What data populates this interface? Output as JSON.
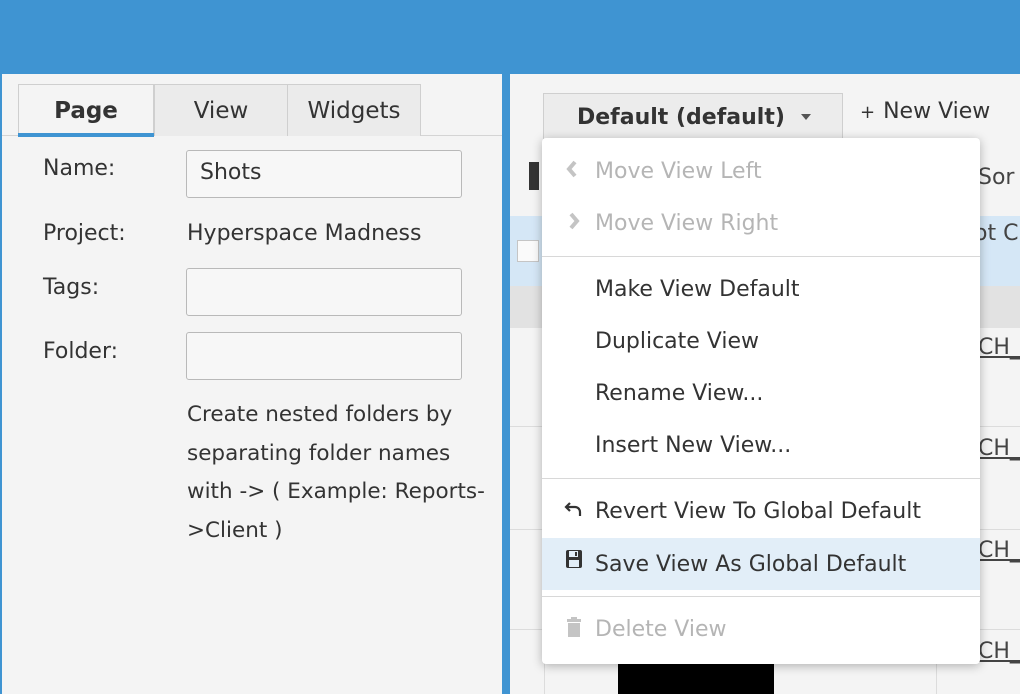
{
  "left_panel": {
    "tabs": [
      {
        "label": "Page"
      },
      {
        "label": "View"
      },
      {
        "label": "Widgets"
      }
    ],
    "form": {
      "name_label": "Name:",
      "name_value": "Shots",
      "project_label": "Project:",
      "project_value": "Hyperspace Madness",
      "tags_label": "Tags:",
      "tags_value": "",
      "folder_label": "Folder:",
      "folder_value": "",
      "folder_help": "Create nested folders by separating folder names with -> ( Example: Reports->Client )"
    }
  },
  "right_panel": {
    "view_select_label": "Default (default)",
    "new_view_label": "New View",
    "background": {
      "sort_label": "Sor",
      "header_label": "ot C",
      "row_links": [
        "CH_",
        "CH_",
        "CH_",
        "CH_"
      ]
    }
  },
  "menu": {
    "items": [
      {
        "label": "Move View Left",
        "icon": "chevron-left-icon",
        "disabled": true
      },
      {
        "label": "Move View Right",
        "icon": "chevron-right-icon",
        "disabled": true
      },
      {
        "label": "Make View Default",
        "icon": "",
        "disabled": false
      },
      {
        "label": "Duplicate View",
        "icon": "",
        "disabled": false
      },
      {
        "label": "Rename View...",
        "icon": "",
        "disabled": false
      },
      {
        "label": "Insert New View...",
        "icon": "",
        "disabled": false
      },
      {
        "label": "Revert View To Global Default",
        "icon": "undo-icon",
        "disabled": false
      },
      {
        "label": "Save View As Global Default",
        "icon": "save-icon",
        "disabled": false,
        "highlighted": true
      },
      {
        "label": "Delete View",
        "icon": "trash-icon",
        "disabled": true
      }
    ]
  },
  "colors": {
    "accent": "#3f94d2",
    "highlight": "#e2eef8",
    "disabled_text": "#b5b5b5"
  }
}
